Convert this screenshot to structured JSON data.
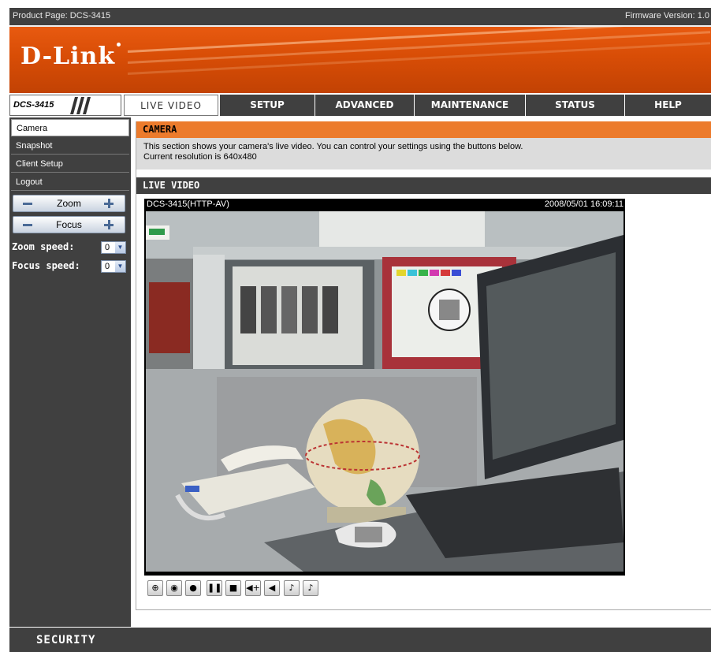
{
  "topbar": {
    "product": "Product Page: DCS-3415",
    "firmware": "Firmware Version: 1.0"
  },
  "brand": {
    "logo": "D-Link"
  },
  "model": "DCS-3415",
  "tabs": [
    {
      "label": "LIVE VIDEO",
      "active": true
    },
    {
      "label": "SETUP"
    },
    {
      "label": "ADVANCED"
    },
    {
      "label": "MAINTENANCE"
    },
    {
      "label": "STATUS"
    },
    {
      "label": "HELP"
    }
  ],
  "sidebar": {
    "items": [
      {
        "label": "Camera",
        "active": true
      },
      {
        "label": "Snapshot"
      },
      {
        "label": "Client Setup"
      },
      {
        "label": "Logout"
      }
    ],
    "zoom_label": "Zoom",
    "focus_label": "Focus",
    "zoom_speed_label": "Zoom speed:",
    "zoom_speed_value": "0",
    "focus_speed_label": "Focus speed:",
    "focus_speed_value": "0"
  },
  "main": {
    "section_title": "CAMERA",
    "description": "This section shows your camera's live video. You can control your settings using the buttons below.",
    "resolution": "Current resolution is 640x480",
    "live_title": "LIVE VIDEO",
    "video": {
      "source": "DCS-3415(HTTP-AV)",
      "timestamp": "2008/05/01 16:09:11"
    },
    "toolbar_icons": [
      "zoom-in-icon",
      "snapshot-icon",
      "record-icon",
      "pause-icon",
      "stop-icon",
      "volume-up-icon",
      "volume-down-icon",
      "microphone-icon",
      "microphone-off-icon"
    ]
  },
  "footer": {
    "label": "SECURITY"
  },
  "colors": {
    "brand_orange": "#d84d06",
    "header_orange": "#ec7b2c",
    "dark_bar": "#404040"
  }
}
